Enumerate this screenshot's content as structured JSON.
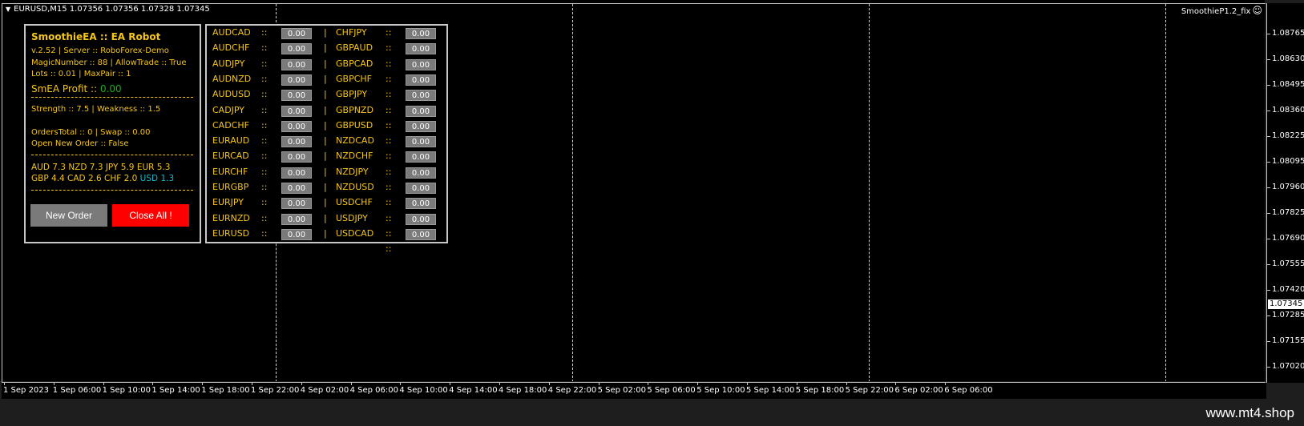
{
  "chart": {
    "symbol_title": "EURUSD,M15  1.07356 1.07356 1.07328 1.07345",
    "indicator_title": "SmoothieP1.2_fix",
    "indicator_icon": "smiley-icon",
    "current_price": "1.07345",
    "price_labels": [
      "1.08765",
      "1.08630",
      "1.08495",
      "1.08360",
      "1.08225",
      "1.08095",
      "1.07960",
      "1.07825",
      "1.07690",
      "1.07555",
      "1.07420",
      "1.07285",
      "1.07155",
      "1.07020"
    ],
    "time_labels": [
      "1 Sep 2023",
      "1 Sep 06:00",
      "1 Sep 10:00",
      "1 Sep 14:00",
      "1 Sep 18:00",
      "1 Sep 22:00",
      "4 Sep 02:00",
      "4 Sep 06:00",
      "4 Sep 10:00",
      "4 Sep 14:00",
      "4 Sep 18:00",
      "4 Sep 22:00",
      "5 Sep 02:00",
      "5 Sep 06:00",
      "5 Sep 10:00",
      "5 Sep 14:00",
      "5 Sep 18:00",
      "5 Sep 22:00",
      "6 Sep 02:00",
      "6 Sep 06:00"
    ]
  },
  "info": {
    "title": "SmoothieEA :: EA Robot",
    "line1": "v.2.52 | Server :: RoboForex-Demo",
    "line2": "MagicNumber :: 88  |  AllowTrade :: True",
    "line3": "Lots :: 0.01   |   MaxPair :: 1",
    "profit_label": "SmEA Profit :: ",
    "profit_value": "0.00",
    "strength": "Strength :: 7.5  |  Weakness :: 1.5",
    "orders": "OrdersTotal :: 0   |   Swap :: 0.00",
    "open_new": "Open New Order :: False",
    "currencies_row1": "AUD  7.3   NZD  7.3   JPY  5.9   EUR  5.3",
    "currencies_row2a": "GBP  4.4   CAD  2.6   CHF  2.0   ",
    "currencies_row2b": "USD  1.3",
    "new_order_label": "New Order",
    "close_all_label": "Close All !"
  },
  "pairs": {
    "left": [
      {
        "name": "AUDCAD",
        "sep": "::",
        "value": "0.00"
      },
      {
        "name": "AUDCHF",
        "sep": "::",
        "value": "0.00"
      },
      {
        "name": "AUDJPY",
        "sep": "::",
        "value": "0.00"
      },
      {
        "name": "AUDNZD",
        "sep": "::",
        "value": "0.00"
      },
      {
        "name": "AUDUSD",
        "sep": "::",
        "value": "0.00"
      },
      {
        "name": "CADJPY",
        "sep": "::",
        "value": "0.00"
      },
      {
        "name": "CADCHF",
        "sep": "::",
        "value": "0.00"
      },
      {
        "name": "EURAUD",
        "sep": "::",
        "value": "0.00"
      },
      {
        "name": "EURCAD",
        "sep": "::",
        "value": "0.00"
      },
      {
        "name": "EURCHF",
        "sep": "::",
        "value": "0.00"
      },
      {
        "name": "EURGBP",
        "sep": "::",
        "value": "0.00"
      },
      {
        "name": "EURJPY",
        "sep": "::",
        "value": "0.00"
      },
      {
        "name": "EURNZD",
        "sep": "::",
        "value": "0.00"
      },
      {
        "name": "EURUSD",
        "sep": "::",
        "value": "0.00"
      }
    ],
    "right": [
      {
        "name": "CHFJPY",
        "sep": "::",
        "value": "0.00"
      },
      {
        "name": "GBPAUD",
        "sep": "::",
        "value": "0.00"
      },
      {
        "name": "GBPCAD",
        "sep": "::",
        "value": "0.00"
      },
      {
        "name": "GBPCHF",
        "sep": "::",
        "value": "0.00"
      },
      {
        "name": "GBPJPY",
        "sep": "::",
        "value": "0.00"
      },
      {
        "name": "GBPNZD",
        "sep": "::",
        "value": "0.00"
      },
      {
        "name": "GBPUSD",
        "sep": "::",
        "value": "0.00"
      },
      {
        "name": "NZDCAD",
        "sep": "::",
        "value": "0.00"
      },
      {
        "name": "NZDCHF",
        "sep": "::",
        "value": "0.00"
      },
      {
        "name": "NZDJPY",
        "sep": "::",
        "value": "0.00"
      },
      {
        "name": "NZDUSD",
        "sep": "::",
        "value": "0.00"
      },
      {
        "name": "USDCHF",
        "sep": "::",
        "value": "0.00"
      },
      {
        "name": "USDJPY",
        "sep": "::",
        "value": "0.00"
      },
      {
        "name": "USDCAD",
        "sep": "::",
        "value": "0.00"
      }
    ],
    "divider": "|",
    "trailing_sep": "::"
  },
  "watermark": "www.mt4.shop",
  "colors": {
    "accent": "#f5c518",
    "profit": "#1fa81f",
    "usd": "#17b8d0",
    "close": "#ff0000",
    "button": "#7a7a7a"
  }
}
